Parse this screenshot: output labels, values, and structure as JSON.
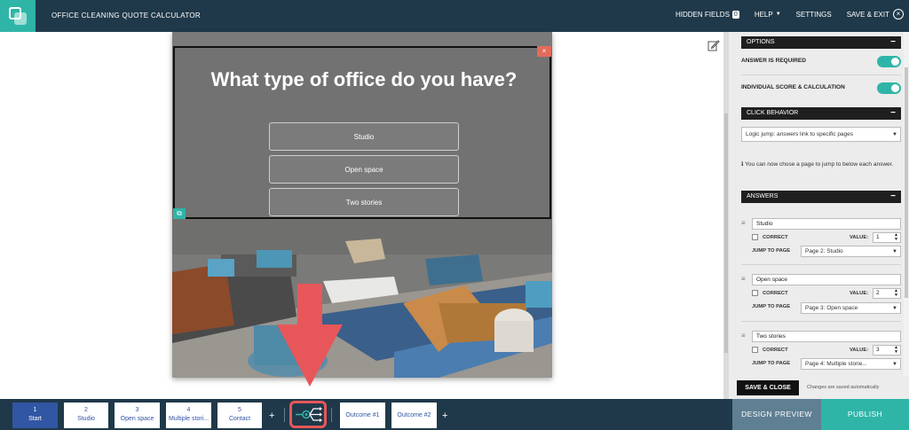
{
  "topbar": {
    "app_title": "OFFICE CLEANING QUOTE CALCULATOR",
    "hidden_fields_label": "HIDDEN FIELDS",
    "hidden_fields_count": "0",
    "help_label": "HELP",
    "settings_label": "SETTINGS",
    "save_exit_label": "SAVE & EXIT"
  },
  "preview": {
    "question": "What type of office do you have?",
    "answers": [
      "Studio",
      "Open space",
      "Two stories"
    ]
  },
  "panel": {
    "options_header": "OPTIONS",
    "answer_required_label": "ANSWER IS REQUIRED",
    "individual_score_label": "INDIVIDUAL SCORE & CALCULATION",
    "click_behavior_header": "CLICK BEHAVIOR",
    "click_behavior_value": "Logic jump: answers link to specific pages",
    "info_text": "You can now chose a page to jump to below each answer.",
    "answers_header": "ANSWERS",
    "correct_label": "CORRECT",
    "value_label": "VALUE:",
    "jump_label": "JUMP TO PAGE",
    "answers": [
      {
        "text": "Studio",
        "value": "1",
        "jump": "Page 2: Studio"
      },
      {
        "text": "Open space",
        "value": "2",
        "jump": "Page 3: Open space"
      },
      {
        "text": "Two stories",
        "value": "3",
        "jump": "Page 4: Multiple storie..."
      }
    ],
    "save_close_label": "SAVE & CLOSE",
    "autosave_text": "Changes are saved automatically"
  },
  "bottombar": {
    "pages": [
      {
        "num": "1",
        "label": "Start"
      },
      {
        "num": "2",
        "label": "Studio"
      },
      {
        "num": "3",
        "label": "Open space"
      },
      {
        "num": "4",
        "label": "Multiple stori..."
      },
      {
        "num": "5",
        "label": "Contact"
      }
    ],
    "outcomes": [
      "Outcome #1",
      "Outcome #2"
    ],
    "design_preview_label": "DESIGN PREVIEW",
    "publish_label": "PUBLISH"
  },
  "colors": {
    "topbar": "#20394a",
    "accent": "#2fb5a8",
    "active_page": "#3156a3",
    "arrow": "#e7575a"
  },
  "icons": [
    "logo-icon",
    "close-circle-icon",
    "edit-icon",
    "logic-flow-icon",
    "down-arrow-icon",
    "drag-handle-icon",
    "info-icon"
  ]
}
